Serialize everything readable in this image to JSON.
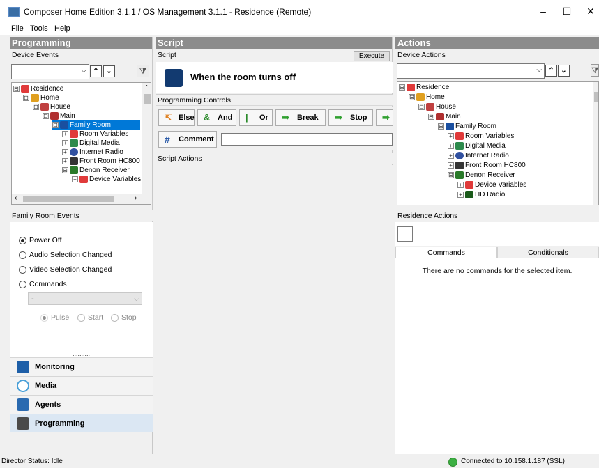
{
  "window": {
    "title": "Composer Home Edition 3.1.1 / OS Management 3.1.1 - Residence (Remote)",
    "minimize": "–",
    "maximize": "☐",
    "close": "✕"
  },
  "menu": [
    "File",
    "Tools",
    "Help"
  ],
  "programming": {
    "header": "Programming",
    "device_events_label": "Device Events",
    "tree": [
      {
        "label": "Residence",
        "expander": "⊟"
      },
      {
        "label": "Home",
        "expander": "⊟"
      },
      {
        "label": "House",
        "expander": "⊟"
      },
      {
        "label": "Main",
        "expander": "⊟"
      },
      {
        "label": "Family Room",
        "expander": "⊟",
        "selected": true
      },
      {
        "label": "Room Variables",
        "expander": "+"
      },
      {
        "label": "Digital Media",
        "expander": "+"
      },
      {
        "label": "Internet Radio",
        "expander": "+"
      },
      {
        "label": "Front Room HC800",
        "expander": "+"
      },
      {
        "label": "Denon Receiver",
        "expander": "⊟"
      },
      {
        "label": "Device Variables",
        "expander": "+"
      }
    ],
    "events_label": "Family Room Events",
    "events": [
      {
        "label": "Power Off",
        "checked": true
      },
      {
        "label": "Audio Selection Changed",
        "checked": false
      },
      {
        "label": "Video Selection Changed",
        "checked": false
      },
      {
        "label": "Commands",
        "checked": false
      }
    ],
    "commands_select": "-",
    "pulse_options": [
      "Pulse",
      "Start",
      "Stop"
    ],
    "splitter": "..........",
    "nav": [
      "Monitoring",
      "Media",
      "Agents",
      "Programming"
    ]
  },
  "script": {
    "header": "Script",
    "script_label": "Script",
    "execute_label": "Execute",
    "event_title": "When the room turns off",
    "controls_label": "Programming Controls",
    "controls": [
      {
        "label": "Else",
        "icon": "else-icon"
      },
      {
        "label": "And",
        "icon": "and-icon"
      },
      {
        "label": "Or",
        "icon": "or-icon"
      },
      {
        "label": "Break",
        "icon": "arrow-right-icon"
      },
      {
        "label": "Stop",
        "icon": "arrow-right-icon"
      }
    ],
    "comment_label": "Comment",
    "comment_value": "",
    "actions_label": "Script Actions"
  },
  "actions": {
    "header": "Actions",
    "device_actions_label": "Device Actions",
    "tree": [
      {
        "label": "Residence",
        "expander": "⊟"
      },
      {
        "label": "Home",
        "expander": "⊟"
      },
      {
        "label": "House",
        "expander": "⊟"
      },
      {
        "label": "Main",
        "expander": "⊟"
      },
      {
        "label": "Family Room",
        "expander": "⊟"
      },
      {
        "label": "Room Variables",
        "expander": "+"
      },
      {
        "label": "Digital Media",
        "expander": "+"
      },
      {
        "label": "Internet Radio",
        "expander": "+"
      },
      {
        "label": "Front Room HC800",
        "expander": "+"
      },
      {
        "label": "Denon Receiver",
        "expander": "⊟"
      },
      {
        "label": "Device Variables",
        "expander": "+"
      },
      {
        "label": "HD Radio",
        "expander": "+"
      }
    ],
    "residence_actions_label": "Residence Actions",
    "tabs": [
      "Commands",
      "Conditionals"
    ],
    "empty_message": "There are no commands for the selected item."
  },
  "status": {
    "director": "Director Status: Idle",
    "connection": "Connected to 10.158.1.187 (SSL)"
  },
  "colors": {
    "header_gray": "#8c8c8c",
    "selection_blue": "#0078d7",
    "connected_green": "#3cb043"
  }
}
